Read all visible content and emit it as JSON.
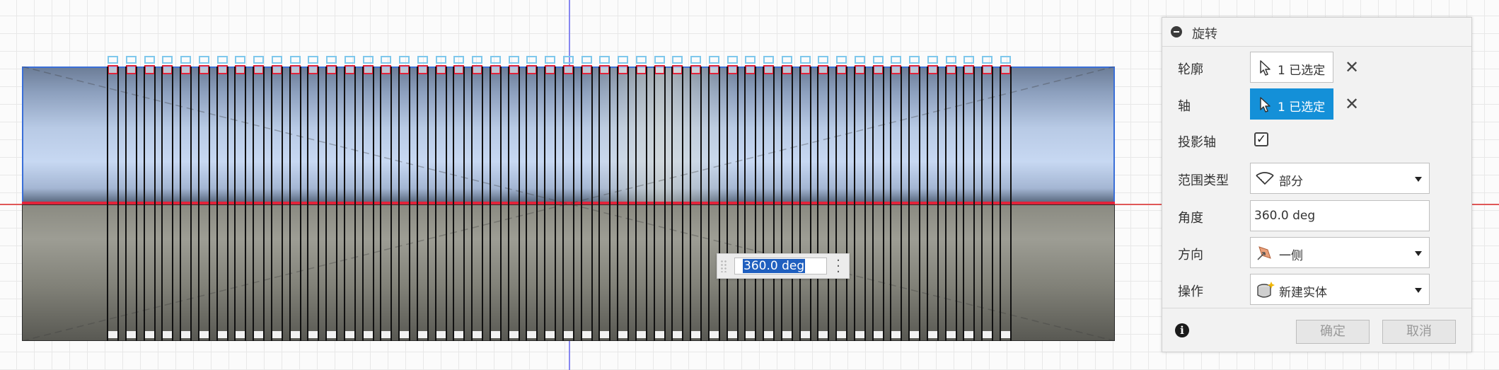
{
  "viewport": {
    "angle_value": "360.0 deg",
    "slot_count": 50
  },
  "panel": {
    "title": "旋转",
    "rows": {
      "profile": {
        "label": "轮廓",
        "value": "1 已选定"
      },
      "axis": {
        "label": "轴",
        "value": "1 已选定"
      },
      "project_axis": {
        "label": "投影轴",
        "checked": true
      },
      "extent_type": {
        "label": "范围类型",
        "value": "部分"
      },
      "angle": {
        "label": "角度",
        "value": "360.0 deg"
      },
      "direction": {
        "label": "方向",
        "value": "一侧"
      },
      "operation": {
        "label": "操作",
        "value": "新建实体"
      }
    },
    "ok_label": "确定",
    "cancel_label": "取消"
  },
  "colors": {
    "accent": "#1490d8",
    "selection_red": "#e2233a",
    "selection_blue": "#3a6fd8"
  }
}
